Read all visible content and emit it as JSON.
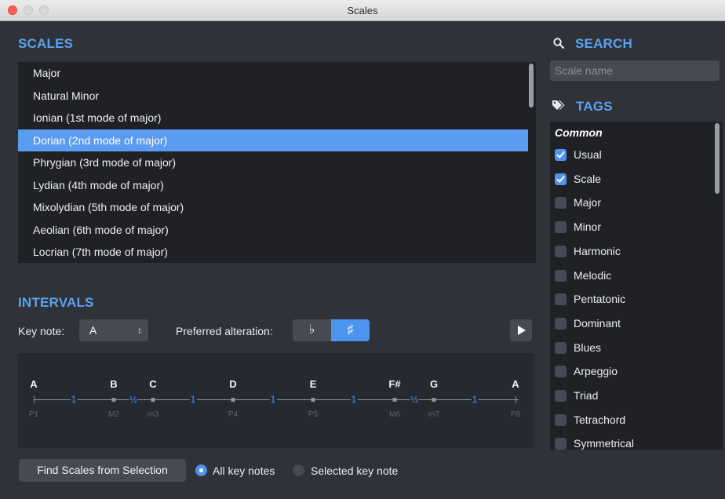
{
  "window": {
    "title": "Scales"
  },
  "scales": {
    "heading": "SCALES",
    "items": [
      "Major",
      "Natural Minor",
      "Ionian (1st mode of major)",
      "Dorian (2nd mode of major)",
      "Phrygian (3rd mode of major)",
      "Lydian (4th mode of major)",
      "Mixolydian (5th mode of major)",
      "Aeolian (6th mode of major)",
      "Locrian (7th mode of major)"
    ],
    "selected": "Dorian (2nd mode of major)"
  },
  "intervals": {
    "heading": "INTERVALS",
    "key_note_label": "Key note:",
    "key_note_value": "A",
    "key_chevron": "↕",
    "alteration_label": "Preferred alteration:",
    "alteration_flat": "♭",
    "alteration_sharp": "♯",
    "alteration_selected": "sharp",
    "notes": [
      "A",
      "B",
      "C",
      "D",
      "E",
      "F#",
      "G",
      "A"
    ],
    "interval_labels": [
      "P1",
      "M2",
      "m3",
      "P4",
      "P5",
      "M6",
      "m7",
      "P8"
    ],
    "steps": [
      "1",
      "½",
      "1",
      "1",
      "1",
      "½",
      "1"
    ]
  },
  "bottom": {
    "find_button": "Find Scales from Selection",
    "radio_all": "All key notes",
    "radio_selected": "Selected key note",
    "radio_checked": "all"
  },
  "search": {
    "heading": "SEARCH",
    "placeholder": "Scale name",
    "value": ""
  },
  "tags": {
    "heading": "TAGS",
    "group": "Common",
    "items": [
      {
        "label": "Usual",
        "checked": true
      },
      {
        "label": "Scale",
        "checked": true
      },
      {
        "label": "Major",
        "checked": false
      },
      {
        "label": "Minor",
        "checked": false
      },
      {
        "label": "Harmonic",
        "checked": false
      },
      {
        "label": "Melodic",
        "checked": false
      },
      {
        "label": "Pentatonic",
        "checked": false
      },
      {
        "label": "Dominant",
        "checked": false
      },
      {
        "label": "Blues",
        "checked": false
      },
      {
        "label": "Arpeggio",
        "checked": false
      },
      {
        "label": "Triad",
        "checked": false
      },
      {
        "label": "Tetrachord",
        "checked": false
      },
      {
        "label": "Symmetrical",
        "checked": false
      }
    ]
  },
  "colors": {
    "accent": "#4d94ee",
    "selected_row": "#5a9cf0",
    "heading": "#5aa2f0",
    "background": "#2f3238",
    "list_bg": "#1f2125"
  }
}
